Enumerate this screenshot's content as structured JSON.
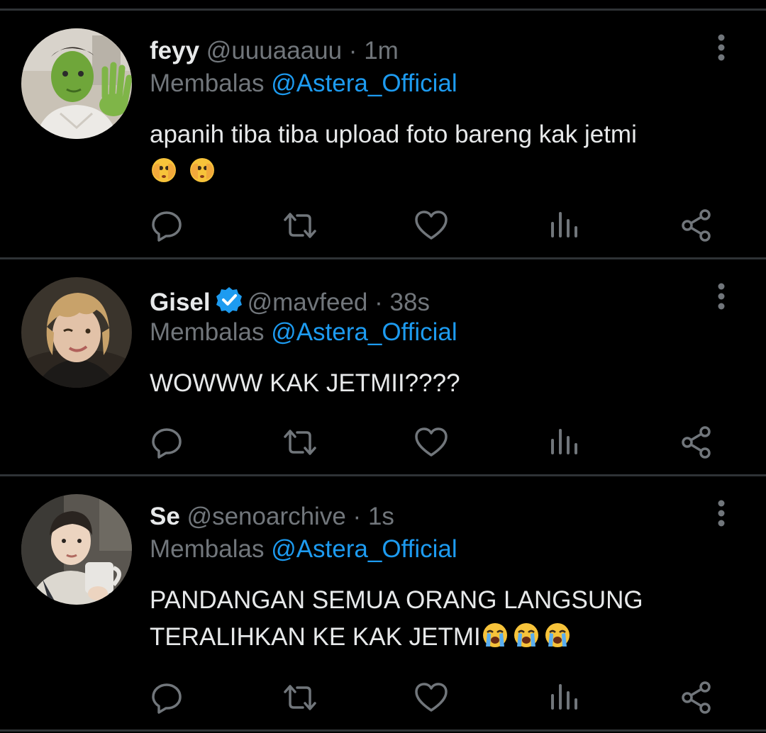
{
  "tweets": [
    {
      "name": "feyy",
      "handle": "@uuuaaauu",
      "separator": "·",
      "time": "1m",
      "verified": false,
      "reply_prefix": "Membalas",
      "reply_to": "@Astera_Official",
      "text_line1": "apanih tiba tiba upload foto bareng kak jetmi",
      "text_emojis": "🫣🫣",
      "avatar_icon": "avatar-green-face-mask"
    },
    {
      "name": "Gisel",
      "handle": "@mavfeed",
      "separator": "·",
      "time": "38s",
      "verified": true,
      "reply_prefix": "Membalas",
      "reply_to": "@Astera_Official",
      "text_line1": "WOWWW KAK JETMII????",
      "avatar_icon": "avatar-blond-hair"
    },
    {
      "name": "Se",
      "handle": "@senoarchive",
      "separator": "·",
      "time": "1s",
      "verified": false,
      "reply_prefix": "Membalas",
      "reply_to": "@Astera_Official",
      "text_line1": "PANDANGAN SEMUA ORANG LANGSUNG",
      "text_line2": "TERALIHKAN KE KAK JETMI",
      "text_emojis": "😭😭😭",
      "avatar_icon": "avatar-holding-mug"
    }
  ],
  "actions": [
    "reply-icon",
    "retweet-icon",
    "like-icon",
    "analytics-icon",
    "share-icon"
  ],
  "colors": {
    "background": "#000000",
    "text": "#e7e9ea",
    "secondary": "#71767b",
    "accent": "#1d9bf0",
    "divider": "#2f3336"
  }
}
